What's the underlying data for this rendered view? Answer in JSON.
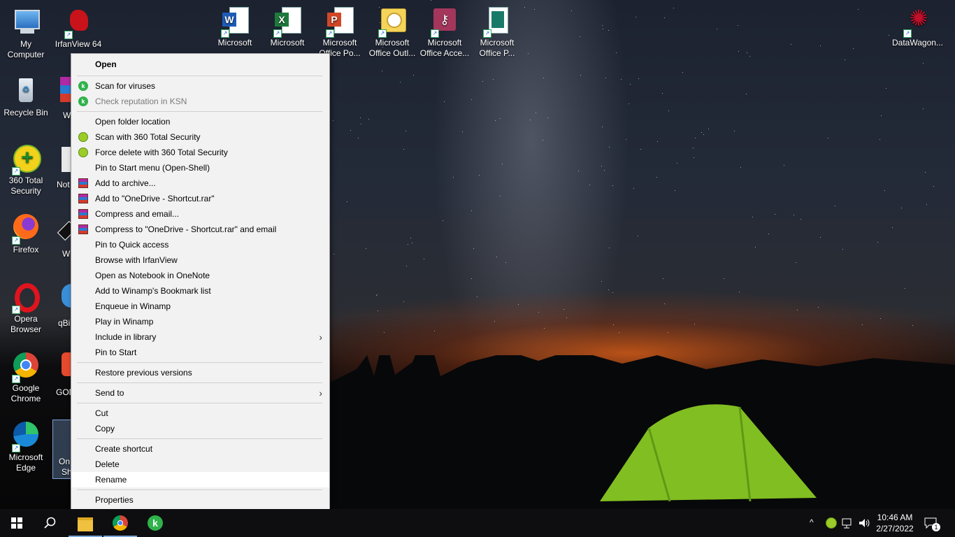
{
  "desktop": {
    "icons": [
      {
        "name": "my-computer",
        "label": "My\nComputer"
      },
      {
        "name": "irfanview",
        "label": "IrfanView 64"
      },
      {
        "name": "word",
        "label": "Microsoft"
      },
      {
        "name": "excel",
        "label": "Microsoft"
      },
      {
        "name": "powerpoint",
        "label": "Microsoft\nOffice Po..."
      },
      {
        "name": "outlook",
        "label": "Microsoft\nOffice Outl..."
      },
      {
        "name": "access",
        "label": "Microsoft\nOffice Acce..."
      },
      {
        "name": "publisher",
        "label": "Microsoft\nOffice P..."
      },
      {
        "name": "datawagon",
        "label": "DataWagon..."
      },
      {
        "name": "recycle-bin",
        "label": "Recycle Bin"
      },
      {
        "name": "360-total-security",
        "label": "360 Total\nSecurity"
      },
      {
        "name": "firefox",
        "label": "Firefox"
      },
      {
        "name": "opera",
        "label": "Opera\nBrowser"
      },
      {
        "name": "google-chrome",
        "label": "Google\nChrome"
      },
      {
        "name": "microsoft-edge",
        "label": "Microsoft\nEdge"
      }
    ],
    "peeks": [
      "W",
      "Not",
      "W",
      "qBi",
      "GOM",
      "On",
      "Sh"
    ]
  },
  "menu": {
    "items": [
      {
        "label": "Open"
      },
      {
        "label": "Scan for viruses"
      },
      {
        "label": "Check reputation in KSN"
      },
      {
        "label": "Open folder location"
      },
      {
        "label": "Scan with 360 Total Security"
      },
      {
        "label": "Force delete with 360 Total Security"
      },
      {
        "label": "Pin to Start menu (Open-Shell)"
      },
      {
        "label": "Add to archive..."
      },
      {
        "label": "Add to \"OneDrive - Shortcut.rar\""
      },
      {
        "label": "Compress and email..."
      },
      {
        "label": "Compress to \"OneDrive - Shortcut.rar\" and email"
      },
      {
        "label": "Pin to Quick access"
      },
      {
        "label": "Browse with IrfanView"
      },
      {
        "label": "Open as Notebook in OneNote"
      },
      {
        "label": "Add to Winamp's Bookmark list"
      },
      {
        "label": "Enqueue in Winamp"
      },
      {
        "label": "Play in Winamp"
      },
      {
        "label": "Include in library"
      },
      {
        "label": "Pin to Start"
      },
      {
        "label": "Restore previous versions"
      },
      {
        "label": "Send to"
      },
      {
        "label": "Cut"
      },
      {
        "label": "Copy"
      },
      {
        "label": "Create shortcut"
      },
      {
        "label": "Delete"
      },
      {
        "label": "Rename"
      },
      {
        "label": "Properties"
      }
    ],
    "submenu_arrow": "›"
  },
  "taskbar": {
    "time": "10:46 AM",
    "date": "2/27/2022",
    "notification_count": "1",
    "tray_chevron": "^"
  },
  "colors": {
    "taskbar_bg": "#0e0e10",
    "menu_bg": "#f2f2f2",
    "highlight": "#ffffff",
    "kaspersky": "#2fb24b"
  }
}
